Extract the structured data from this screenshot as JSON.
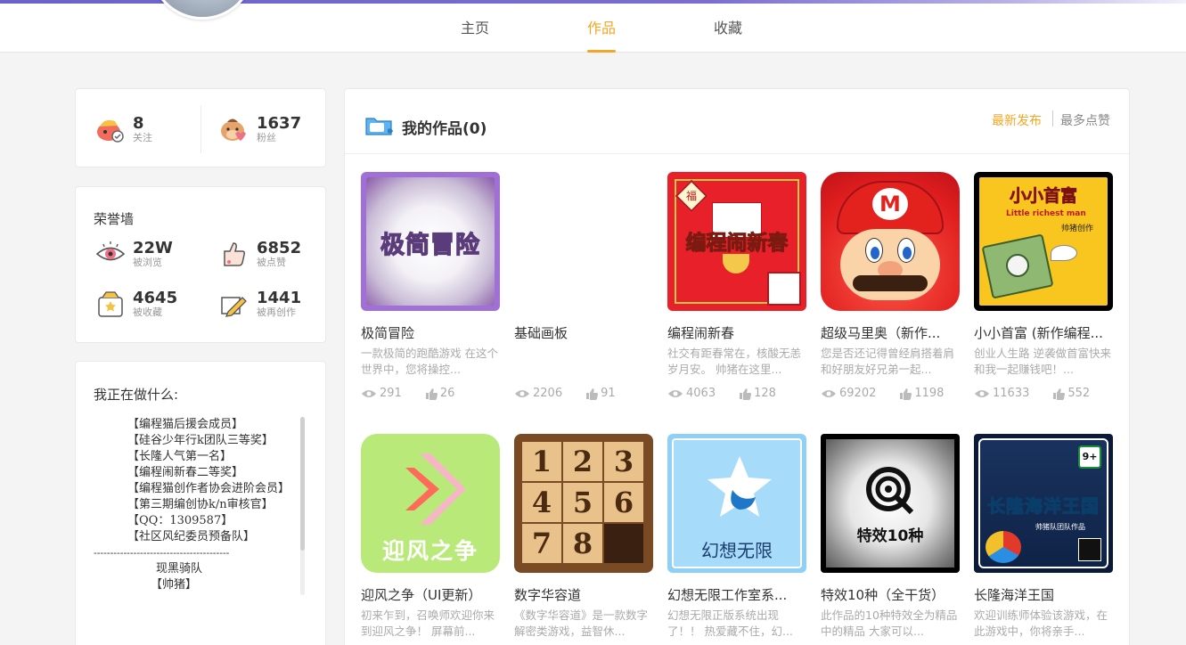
{
  "tabs": [
    {
      "label": "主页"
    },
    {
      "label": "作品"
    },
    {
      "label": "收藏"
    }
  ],
  "stats": {
    "follow": {
      "num": "8",
      "label": "关注"
    },
    "fans": {
      "num": "1637",
      "label": "粉丝"
    }
  },
  "honor": {
    "title": "荣誉墙",
    "viewed": {
      "num": "22W",
      "label": "被浏览"
    },
    "liked": {
      "num": "6852",
      "label": "被点赞"
    },
    "collected": {
      "num": "4645",
      "label": "被收藏"
    },
    "recreated": {
      "num": "1441",
      "label": "被再创作"
    }
  },
  "doing": {
    "title": "我正在做什么:",
    "lines": [
      "【编程猫后援会成员】",
      "【硅谷少年行k团队三等奖】",
      "【长隆人气第一名】",
      "【编程闹新春二等奖】",
      "【编程猫创作者协会进阶会员】",
      "【第三期编创协k/n审核官】",
      "【QQ：1309587】",
      "【社区风纪委员预备队】",
      "-----------------------------------------",
      "现黑骑队",
      "【帅猪】"
    ]
  },
  "works_panel": {
    "title": "我的作品(0)",
    "sort_latest": "最新发布",
    "sort_likes": "最多点赞"
  },
  "works": [
    {
      "title": "极简冒险",
      "desc": "一款极简的跑酷游戏 在这个世界中，您将操控...",
      "views": "291",
      "likes": "26",
      "thumb_text": "极简冒险"
    },
    {
      "title": "基础画板",
      "desc": "",
      "views": "2206",
      "likes": "91",
      "thumb_text": ""
    },
    {
      "title": "编程闹新春",
      "desc": "社交有距春常在，核酸无恙岁月安。 帅猪在这里...",
      "views": "4063",
      "likes": "128",
      "thumb_text": "编程闹新春"
    },
    {
      "title": "超级马里奥（新作...",
      "desc": "您是否还记得曾经肩搭着肩和好朋友好兄弟一起...",
      "views": "69202",
      "likes": "1198",
      "thumb_text": ""
    },
    {
      "title": "小小首富 (新作编程...",
      "desc": "创业人生路 逆袭做首富快来和我一起赚钱吧！...",
      "views": "11633",
      "likes": "552",
      "thumb_text": "小小首富"
    },
    {
      "title": "迎风之争（UI更新）",
      "desc": "初来乍到，召唤师欢迎你来到迎风之争！ 屏幕前...",
      "views": "",
      "likes": "",
      "thumb_text": "迎风之争"
    },
    {
      "title": "数字华容道",
      "desc": "《数字华容道》是一款数字解密类游戏，益智休...",
      "views": "",
      "likes": "",
      "thumb_text": ""
    },
    {
      "title": "幻想无限工作室系...",
      "desc": "幻想无限正版系统出现了！！ 热爱藏不住，幻...",
      "views": "",
      "likes": "",
      "thumb_text": "幻想无限"
    },
    {
      "title": "特效10种（全干货）",
      "desc": "此作品的10种特效全为精品中的精品 大家可以...",
      "views": "",
      "likes": "",
      "thumb_text": "特效10种"
    },
    {
      "title": "长隆海洋王国",
      "desc": "欢迎训练师体验该游戏，在此游戏中，你将亲手...",
      "views": "",
      "likes": "",
      "thumb_text": "长隆海洋王国"
    }
  ],
  "thumb_extras": {
    "fu": "福",
    "little_richest": "Little richest man",
    "author_tag": "帅猪创作",
    "mario_m": "M",
    "puzzle_digits": [
      "1",
      "2",
      "3",
      "4",
      "5",
      "6",
      "7",
      "8"
    ],
    "age_badge": "9+",
    "team_tag": "帅猪队团队作品"
  },
  "colors": {
    "accent": "#f5a623",
    "muted": "#aaaaaa"
  },
  "icons": [
    "eye-icon",
    "thumb-up-icon",
    "folder-icon"
  ]
}
